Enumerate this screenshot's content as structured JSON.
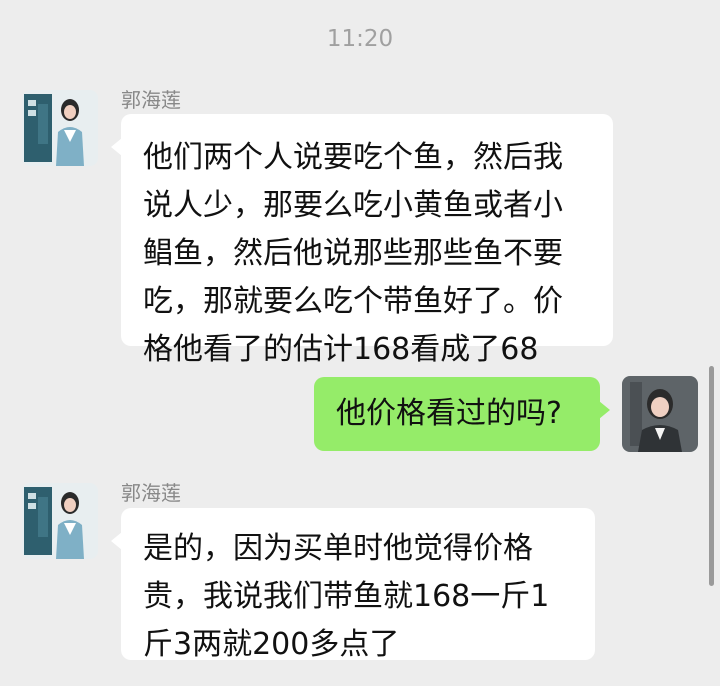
{
  "timestamp": "11:20",
  "messages": [
    {
      "direction": "incoming",
      "sender": "郭海莲",
      "text": "他们两个人说要吃个鱼，然后我说人少，那要么吃小黄鱼或者小鲳鱼，然后他说那些那些鱼不要吃，那就要么吃个带鱼好了。价格他看了的估计168看成了68"
    },
    {
      "direction": "outgoing",
      "text": "他价格看过的吗?"
    },
    {
      "direction": "incoming",
      "sender": "郭海莲",
      "text": "是的，因为买单时他觉得价格贵，我说我们带鱼就168一斤1斤3两就200多点了"
    }
  ],
  "colors": {
    "background": "#ededed",
    "incoming_bubble": "#ffffff",
    "outgoing_bubble": "#95ec69"
  }
}
